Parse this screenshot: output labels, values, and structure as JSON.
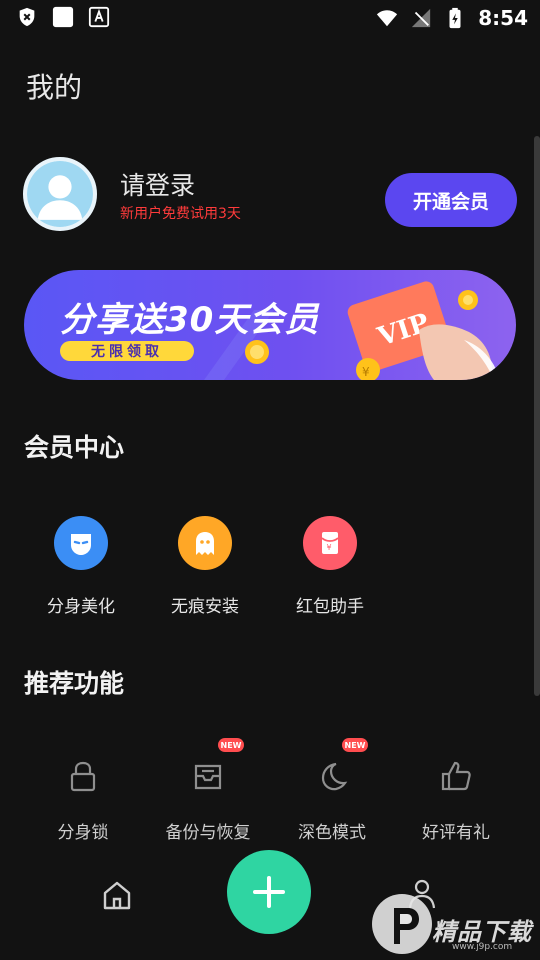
{
  "status_bar": {
    "time": "8:54"
  },
  "page": {
    "title": "我的"
  },
  "profile": {
    "login_label": "请登录",
    "trial_text": "新用户免费试用3天",
    "vip_button": "开通会员"
  },
  "banner": {
    "title": "分享送30天会员",
    "tag": "无限领取",
    "card_text": "VIP",
    "coin_symbol": "¥"
  },
  "member_center": {
    "title": "会员中心",
    "items": [
      {
        "label": "分身美化",
        "icon": "mask-icon",
        "color": "#3b8ef5"
      },
      {
        "label": "无痕安装",
        "icon": "ghost-icon",
        "color": "#ffa726"
      },
      {
        "label": "红包助手",
        "icon": "red-envelope-icon",
        "color": "#ff5c6a"
      }
    ]
  },
  "recommend": {
    "title": "推荐功能",
    "items": [
      {
        "label": "分身锁",
        "icon": "lock-icon",
        "badge": ""
      },
      {
        "label": "备份与恢复",
        "icon": "backup-tray-icon",
        "badge": "NEW"
      },
      {
        "label": "深色模式",
        "icon": "moon-icon",
        "badge": "NEW"
      },
      {
        "label": "好评有礼",
        "icon": "thumbs-up-icon",
        "badge": ""
      }
    ]
  },
  "watermark": {
    "text": "精品下载",
    "url": "www.j9p.com"
  },
  "colors": {
    "accent": "#5b47f0",
    "fab": "#2fd5a2",
    "trial": "#ff3b3b"
  }
}
